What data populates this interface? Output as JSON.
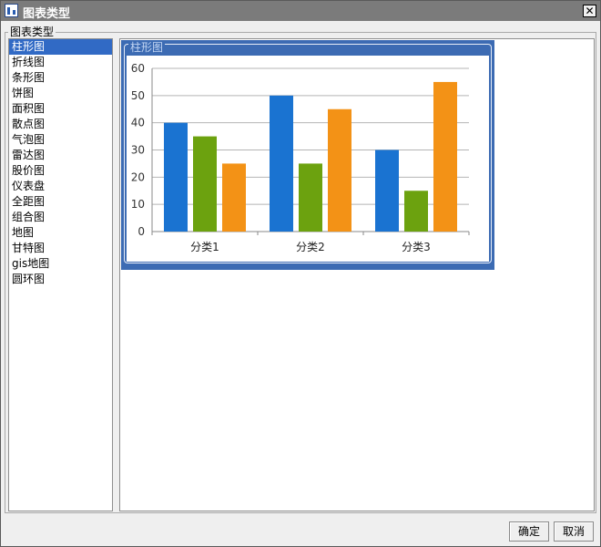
{
  "window": {
    "title": "图表类型",
    "close_glyph": "✕"
  },
  "group": {
    "label": "图表类型"
  },
  "chart_types": [
    "柱形图",
    "折线图",
    "条形图",
    "饼图",
    "面积图",
    "散点图",
    "气泡图",
    "雷达图",
    "股价图",
    "仪表盘",
    "全距图",
    "组合图",
    "地图",
    "甘特图",
    "gis地图",
    "圆环图"
  ],
  "selected_index": 0,
  "preview": {
    "caption": "柱形图"
  },
  "chart_data": {
    "type": "bar",
    "categories": [
      "分类1",
      "分类2",
      "分类3"
    ],
    "series": [
      {
        "values": [
          40,
          50,
          30
        ],
        "color": "#1a73d1"
      },
      {
        "values": [
          35,
          25,
          15
        ],
        "color": "#6ca20f"
      },
      {
        "values": [
          25,
          45,
          55
        ],
        "color": "#f39216"
      }
    ],
    "ylim": [
      0,
      60
    ],
    "yticks": [
      0,
      10,
      20,
      30,
      40,
      50,
      60
    ],
    "grid": true
  },
  "buttons": {
    "ok": "确定",
    "cancel": "取消"
  }
}
